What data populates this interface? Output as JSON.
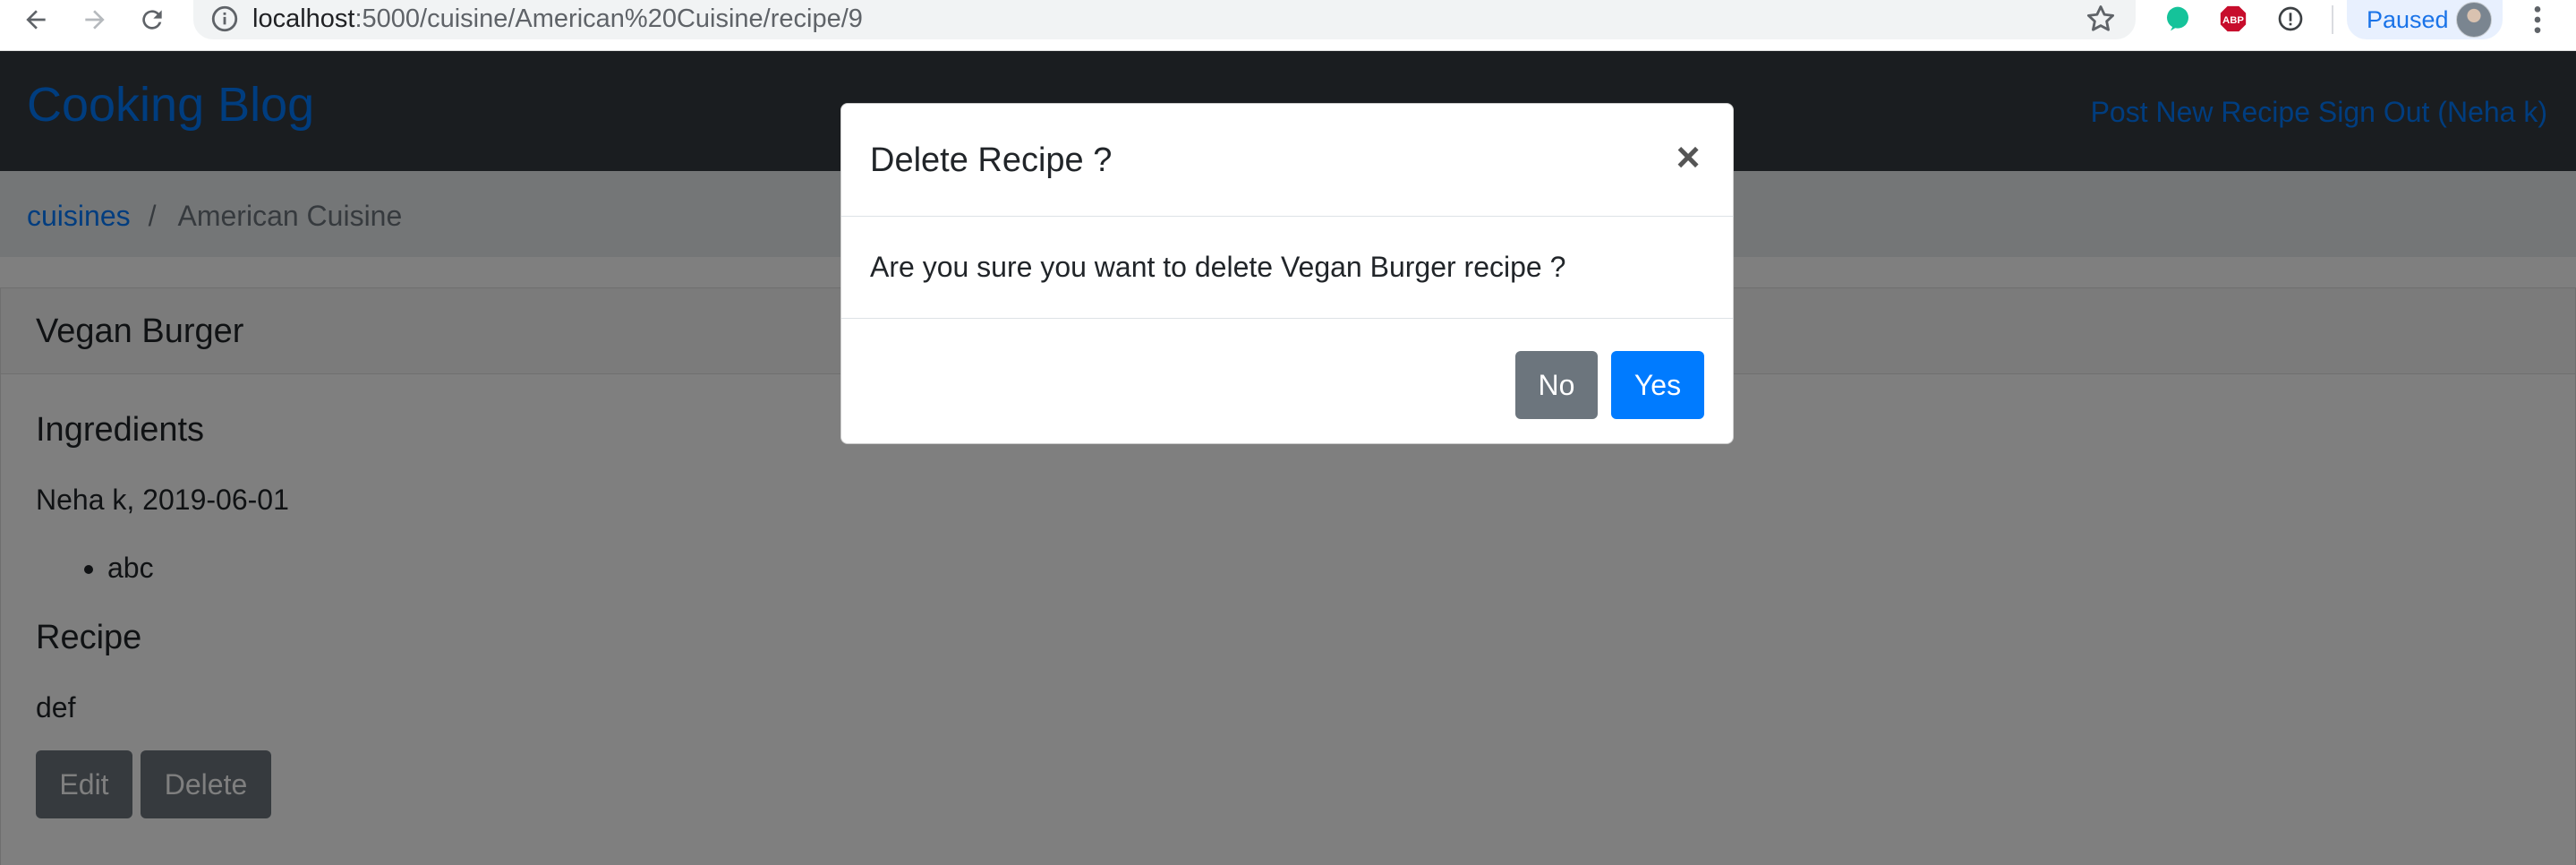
{
  "browser": {
    "url_host": "localhost",
    "url_path": ":5000/cuisine/American%20Cuisine/recipe/9",
    "profile_status": "Paused",
    "extensions": [
      {
        "name": "grammarly-icon",
        "color": "#15c39a"
      },
      {
        "name": "adblock-icon",
        "label": "ABP",
        "color": "#c70d2c"
      },
      {
        "name": "info-circle-icon"
      }
    ]
  },
  "navbar": {
    "brand": "Cooking Blog",
    "links": [
      "Post New Recipe",
      "Sign Out (Neha k)"
    ]
  },
  "breadcrumb": {
    "items": [
      "cuisines",
      "American Cuisine"
    ],
    "separator": "/"
  },
  "recipe": {
    "title": "Vegan Burger",
    "ingredients_heading": "Ingredients",
    "byline": "Neha k, 2019-06-01",
    "ingredients": [
      "abc"
    ],
    "recipe_heading": "Recipe",
    "recipe_text": "def",
    "edit_label": "Edit",
    "delete_label": "Delete"
  },
  "modal": {
    "title": "Delete Recipe ?",
    "close_glyph": "×",
    "message": "Are you sure you want to delete Vegan Burger recipe ?",
    "no_label": "No",
    "yes_label": "Yes"
  },
  "colors": {
    "primary": "#007bff",
    "secondary": "#6c757d",
    "navbar": "#343a40",
    "breadcrumb_bg": "#e9ecef"
  }
}
